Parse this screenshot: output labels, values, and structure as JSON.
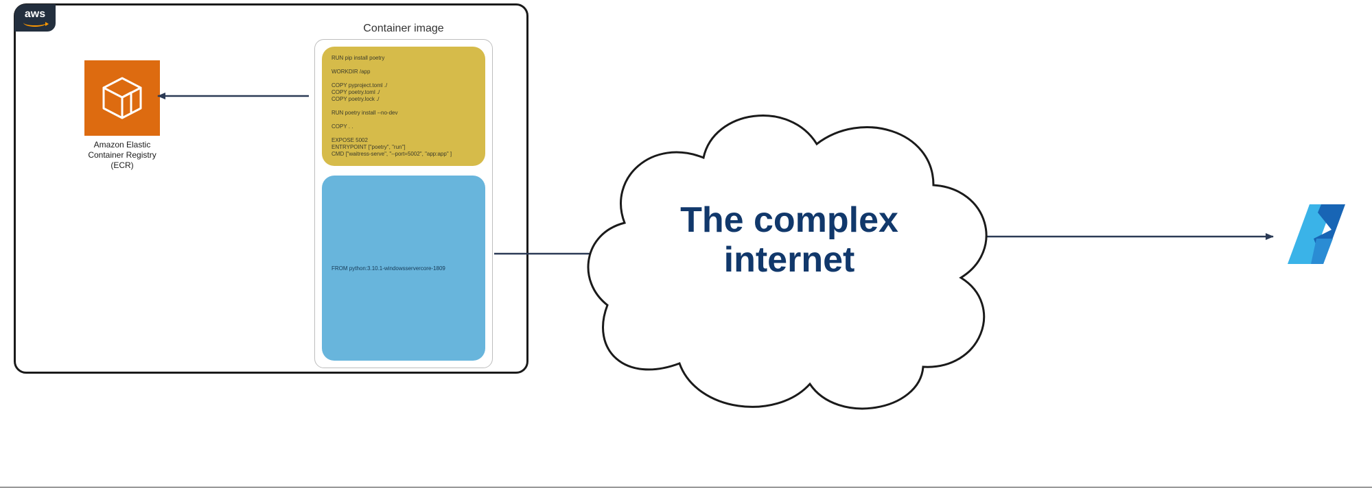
{
  "aws": {
    "label": "aws"
  },
  "ecr": {
    "caption_line1": "Amazon Elastic Container Registry",
    "caption_line2": "(ECR)"
  },
  "container_image": {
    "title": "Container image",
    "dockerfile_top": "RUN pip install poetry\n\nWORKDIR /app\n\nCOPY pyproject.toml ./\nCOPY poetry.toml ./\nCOPY poetry.lock ./\n\nRUN poetry install --no-dev\n\nCOPY . .\n\nEXPOSE 5002\nENTRYPOINT [\"poetry\", \"run\"]\nCMD [\"waitress-serve\", \"--port=5002\", \"app:app\" ]",
    "dockerfile_bottom": "FROM python:3.10.1-windowsservercore-1809"
  },
  "cloud": {
    "label": "The complex\ninternet"
  },
  "arrows": {
    "container_to_ecr": true,
    "container_to_cloud": true,
    "cloud_to_azure": true
  },
  "colors": {
    "aws_badge_bg": "#232f3e",
    "aws_smile": "#ff9900",
    "ecr_orange": "#dd6b10",
    "docker_top": "#d6bb4a",
    "docker_bottom": "#68b5dc",
    "cloud_text": "#11386b",
    "arrow": "#2b3a55"
  }
}
